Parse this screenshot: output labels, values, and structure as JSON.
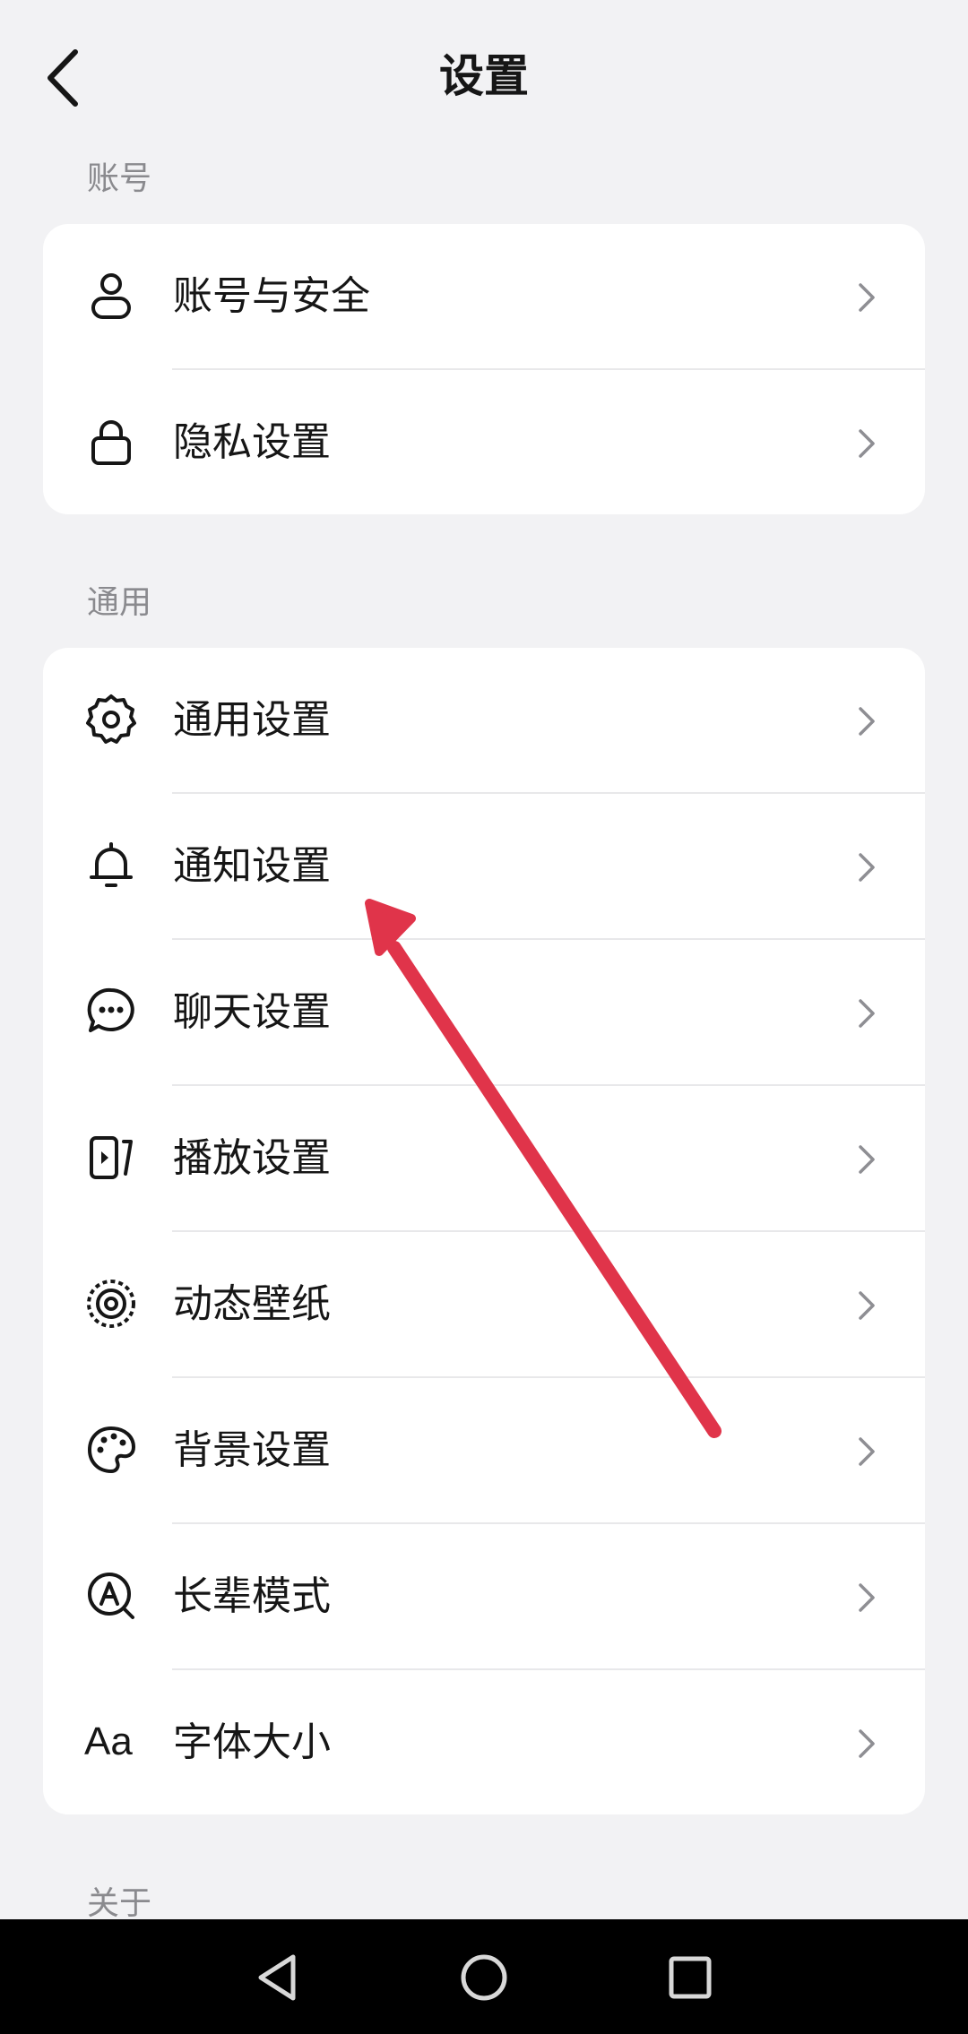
{
  "header": {
    "title": "设置"
  },
  "sections": [
    {
      "label": "账号",
      "items": [
        {
          "label": "账号与安全",
          "icon": "person-icon"
        },
        {
          "label": "隐私设置",
          "icon": "lock-icon"
        }
      ]
    },
    {
      "label": "通用",
      "items": [
        {
          "label": "通用设置",
          "icon": "gear-icon"
        },
        {
          "label": "通知设置",
          "icon": "bell-icon"
        },
        {
          "label": "聊天设置",
          "icon": "chat-bubble-icon"
        },
        {
          "label": "播放设置",
          "icon": "play-panel-icon"
        },
        {
          "label": "动态壁纸",
          "icon": "target-icon"
        },
        {
          "label": "背景设置",
          "icon": "palette-icon"
        },
        {
          "label": "长辈模式",
          "icon": "elder-mode-icon"
        },
        {
          "label": "字体大小",
          "icon": "font-size-icon",
          "icon_text": "Aa"
        }
      ]
    },
    {
      "label": "关于"
    }
  ],
  "colors": {
    "background": "#f2f2f4",
    "card": "#ffffff",
    "arrow": "#e0344a",
    "navbar": "#000000"
  }
}
